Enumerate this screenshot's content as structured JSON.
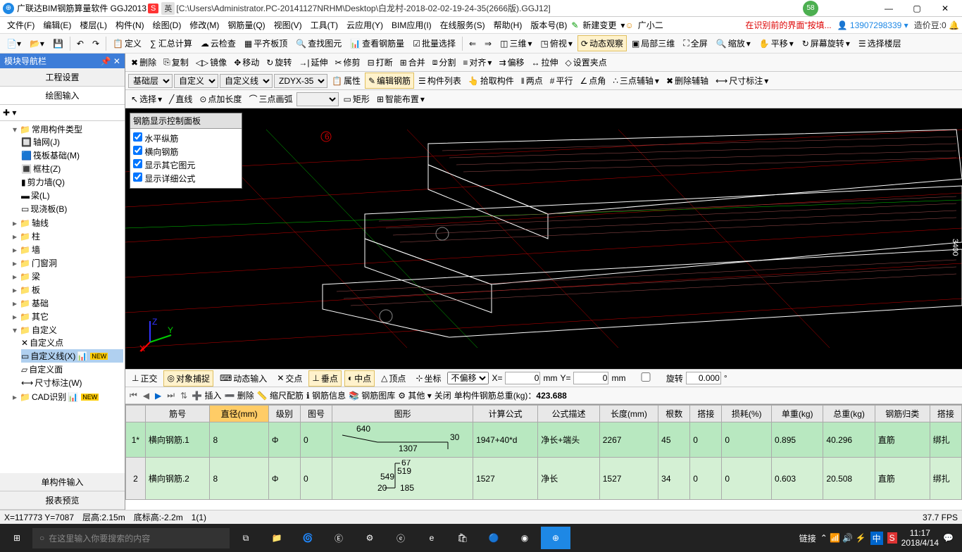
{
  "titlebar": {
    "app_name": "广联达BIM钢筋算量软件 GGJ2013",
    "path": "[C:\\Users\\Administrator.PC-20141127NRHM\\Desktop\\白龙村-2018-02-02-19-24-35(2666版).GGJ12]",
    "ime1": "S",
    "ime2": "英",
    "badge": "58"
  },
  "menu": {
    "items": [
      "文件(F)",
      "编辑(E)",
      "楼层(L)",
      "构件(N)",
      "绘图(D)",
      "修改(M)",
      "钢筋量(Q)",
      "视图(V)",
      "工具(T)",
      "云应用(Y)",
      "BIM应用(I)",
      "在线服务(S)",
      "帮助(H)",
      "版本号(B)"
    ],
    "new_change": "新建变更",
    "assistant": "广小二",
    "rec_text": "在识别前的界面\"按填...",
    "user": "13907298339",
    "coin_label": "造价豆:",
    "coin_value": "0"
  },
  "toolbar1": {
    "define": "定义",
    "sum_calc": "∑ 汇总计算",
    "cloud_check": "云检查",
    "flat_roof": "平齐板顶",
    "find_ent": "查找图元",
    "view_rebar": "查看钢筋量",
    "batch_sel": "批量选择",
    "three_d": "三维",
    "top_view": "俯视",
    "dyn_view": "动态观察",
    "local_3d": "局部三维",
    "full": "全屏",
    "zoom": "缩放",
    "pan": "平移",
    "screen_rot": "屏幕旋转",
    "sel_floor": "选择楼层"
  },
  "toolbar2": {
    "delete": "删除",
    "copy": "复制",
    "mirror": "镜像",
    "move": "移动",
    "rotate": "旋转",
    "extend": "延伸",
    "trim": "修剪",
    "break": "打断",
    "merge": "合并",
    "split": "分割",
    "align": "对齐",
    "offset": "偏移",
    "stretch": "拉伸",
    "set_pt": "设置夹点"
  },
  "toolbar3": {
    "floor": "基础层",
    "cat": "自定义",
    "subcat": "自定义线",
    "name": "ZDYX-35",
    "attr": "属性",
    "edit_rebar": "编辑钢筋",
    "list": "构件列表",
    "pick": "拾取构件",
    "two_pt": "两点",
    "parallel": "平行",
    "angle": "点角",
    "three_aux": "三点辅轴",
    "del_aux": "删除辅轴",
    "dim": "尺寸标注"
  },
  "toolbar4": {
    "select": "选择",
    "line": "直线",
    "pt_len": "点加长度",
    "arc3": "三点画弧",
    "rect": "矩形",
    "smart": "智能布置"
  },
  "sidebar": {
    "title": "模块导航栏",
    "tab1": "工程设置",
    "tab2": "绘图输入",
    "root": "常用构件类型",
    "items": {
      "axis_net": "轴网(J)",
      "raft": "筏板基础(M)",
      "col": "框柱(Z)",
      "shear": "剪力墙(Q)",
      "beam": "梁(L)",
      "slab": "现浇板(B)",
      "axis": "轴线",
      "pillar": "柱",
      "wall": "墙",
      "opening": "门窗洞",
      "liang": "梁",
      "ban": "板",
      "found": "基础",
      "other": "其它",
      "custom": "自定义",
      "custom_pt": "自定义点",
      "custom_ln": "自定义线(X)",
      "custom_face": "自定义面",
      "dim_note": "尺寸标注(W)",
      "cad": "CAD识别"
    },
    "footer1": "单构件输入",
    "footer2": "报表预览",
    "new": "NEW"
  },
  "rebar_panel": {
    "title": "钢筋显示控制面板",
    "opt1": "水平纵筋",
    "opt2": "横向钢筋",
    "opt3": "显示其它图元",
    "opt4": "显示详细公式"
  },
  "viewport": {
    "marker": "6",
    "dim": "3400"
  },
  "snapbar": {
    "ortho": "正交",
    "osnap": "对象捕捉",
    "dyn": "动态输入",
    "cross": "交点",
    "perp": "垂点",
    "mid": "中点",
    "vertex": "顶点",
    "coord": "坐标",
    "no_offset": "不偏移",
    "x_label": "X=",
    "x_val": "0",
    "x_unit": "mm",
    "y_label": "Y=",
    "y_val": "0",
    "y_unit": "mm",
    "rot": "旋转",
    "rot_val": "0.000"
  },
  "tablebar": {
    "insert": "插入",
    "delete": "删除",
    "scale": "缩尺配筋",
    "info": "钢筋信息",
    "lib": "钢筋图库",
    "other": "其他",
    "close": "关闭",
    "total_label": "单构件钢筋总重(kg)：",
    "total_val": "423.688"
  },
  "grid": {
    "headers": [
      "",
      "筋号",
      "直径(mm)",
      "级别",
      "图号",
      "图形",
      "计算公式",
      "公式描述",
      "长度(mm)",
      "根数",
      "搭接",
      "损耗(%)",
      "单重(kg)",
      "总重(kg)",
      "钢筋归类",
      "搭接"
    ],
    "rows": [
      {
        "n": "1*",
        "name": "横向钢筋.1",
        "dia": "8",
        "grade": "Φ",
        "fig": "0",
        "shape_labels": [
          "640",
          "1307",
          "30"
        ],
        "formula": "1947+40*d",
        "desc": "净长+端头",
        "len": "2267",
        "count": "45",
        "lap": "0",
        "loss": "0",
        "unit_w": "0.895",
        "total_w": "40.296",
        "cat": "直筋",
        "lap2": "绑扎"
      },
      {
        "n": "2",
        "name": "横向钢筋.2",
        "dia": "8",
        "grade": "Φ",
        "fig": "0",
        "shape_labels": [
          "67",
          "519",
          "549",
          "20",
          "185"
        ],
        "formula": "1527",
        "desc": "净长",
        "len": "1527",
        "count": "34",
        "lap": "0",
        "loss": "0",
        "unit_w": "0.603",
        "total_w": "20.508",
        "cat": "直筋",
        "lap2": "绑扎"
      }
    ]
  },
  "status": {
    "coords": "X=117773 Y=7087",
    "floor_h": "层高:2.15m",
    "bottom_h": "底标高:-2.2m",
    "count": "1(1)",
    "fps": "37.7 FPS"
  },
  "taskbar": {
    "search_placeholder": "在这里输入你要搜索的内容",
    "link": "链接",
    "ime_zh": "中",
    "time": "11:17",
    "date": "2018/4/14"
  }
}
